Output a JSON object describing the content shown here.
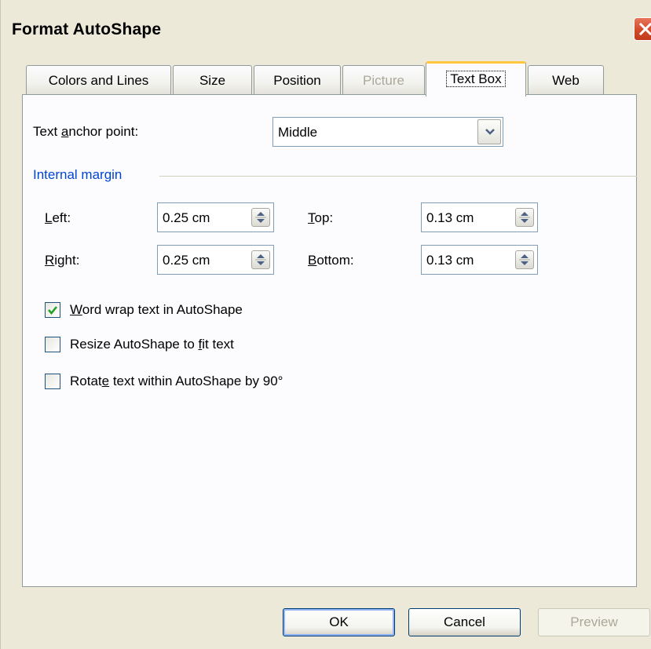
{
  "window": {
    "title": "Format AutoShape"
  },
  "tabs": [
    {
      "label": "Colors and Lines",
      "state": "normal"
    },
    {
      "label": "Size",
      "state": "normal"
    },
    {
      "label": "Position",
      "state": "normal"
    },
    {
      "label": "Picture",
      "state": "disabled"
    },
    {
      "label": "Text Box",
      "state": "active"
    },
    {
      "label": "Web",
      "state": "normal"
    }
  ],
  "text_box": {
    "anchor_label_pre": "Text ",
    "anchor_label_key": "a",
    "anchor_label_post": "nchor point:",
    "anchor_value": "Middle",
    "group_label": "Internal margin",
    "margins": {
      "left": {
        "label_key": "L",
        "label_rest": "eft:",
        "value": "0.25 cm"
      },
      "right": {
        "label_key": "R",
        "label_rest": "ight:",
        "value": "0.25 cm"
      },
      "top": {
        "label_key": "T",
        "label_rest": "op:",
        "value": "0.13 cm"
      },
      "bottom": {
        "label_key": "B",
        "label_rest": "ottom:",
        "value": "0.13 cm"
      }
    },
    "checkboxes": [
      {
        "pre": "",
        "key": "W",
        "post": "ord wrap text in AutoShape",
        "checked": true
      },
      {
        "pre": "Resize AutoShape to ",
        "key": "f",
        "post": "it text",
        "checked": false
      },
      {
        "pre": "Rotat",
        "key": "e",
        "post": " text within AutoShape by 90°",
        "checked": false
      }
    ]
  },
  "buttons": {
    "ok": "OK",
    "cancel": "Cancel",
    "preview": "Preview"
  },
  "colors": {
    "accent_tab": "#ffc83c",
    "group_label": "#0046d5",
    "checkmark": "#21a121"
  }
}
